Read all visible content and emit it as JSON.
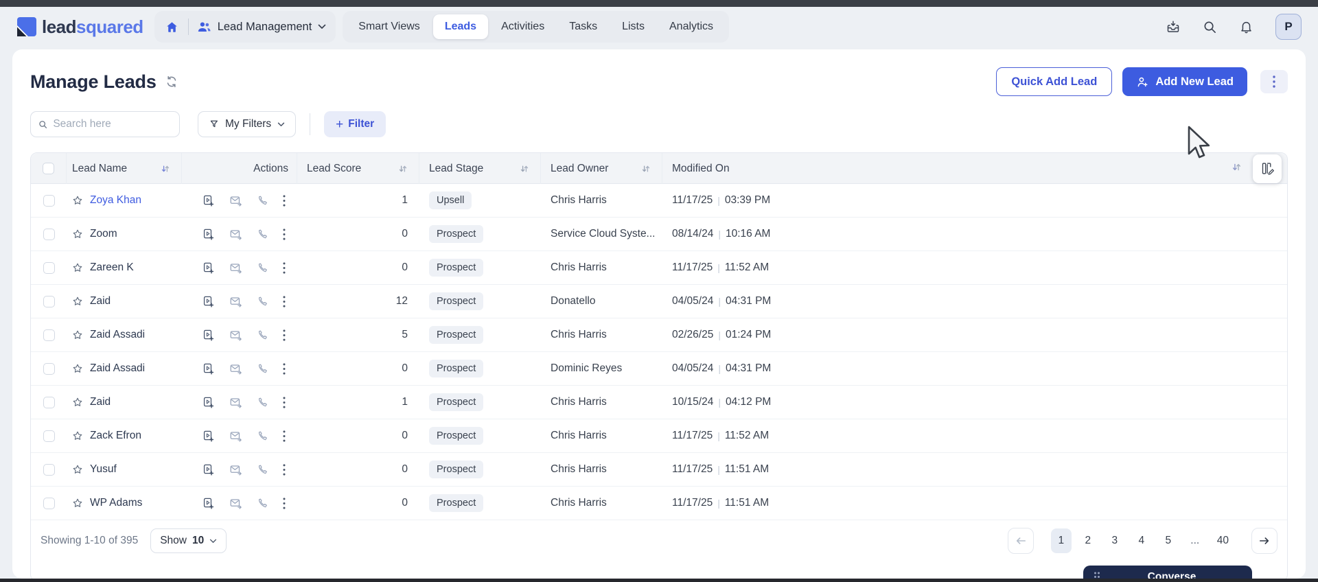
{
  "brand": {
    "part1": "lead",
    "part2": "squared"
  },
  "nav": {
    "menu_label": "Lead Management",
    "tabs": [
      {
        "label": "Smart Views",
        "active": false
      },
      {
        "label": "Leads",
        "active": true
      },
      {
        "label": "Activities",
        "active": false
      },
      {
        "label": "Tasks",
        "active": false
      },
      {
        "label": "Lists",
        "active": false
      },
      {
        "label": "Analytics",
        "active": false
      }
    ],
    "icons": [
      "home-icon",
      "users-icon",
      "inbox-download-icon",
      "search-icon",
      "bell-icon"
    ],
    "avatar_initial": "P"
  },
  "header": {
    "title": "Manage Leads",
    "quick_add_label": "Quick Add Lead",
    "add_new_label": "Add New Lead"
  },
  "toolbar": {
    "search_placeholder": "Search here",
    "my_filters_label": "My Filters",
    "filter_plus": "+",
    "filter_label": "Filter"
  },
  "table": {
    "separator": "|",
    "columns": [
      {
        "label": "Lead Name",
        "sortable": true
      },
      {
        "label": "Actions",
        "sortable": false
      },
      {
        "label": "Lead Score",
        "sortable": true
      },
      {
        "label": "Lead Stage",
        "sortable": true
      },
      {
        "label": "Lead Owner",
        "sortable": true
      },
      {
        "label": "Modified On",
        "sortable": false
      }
    ],
    "rows": [
      {
        "name": "Zoya Khan",
        "link": true,
        "score": "1",
        "stage": "Upsell",
        "owner": "Chris Harris",
        "date": "11/17/25",
        "time": "03:39 PM"
      },
      {
        "name": "Zoom",
        "link": false,
        "score": "0",
        "stage": "Prospect",
        "owner": "Service Cloud Syste...",
        "date": "08/14/24",
        "time": "10:16 AM"
      },
      {
        "name": "Zareen K",
        "link": false,
        "score": "0",
        "stage": "Prospect",
        "owner": "Chris Harris",
        "date": "11/17/25",
        "time": "11:52 AM"
      },
      {
        "name": "Zaid",
        "link": false,
        "score": "12",
        "stage": "Prospect",
        "owner": "Donatello",
        "date": "04/05/24",
        "time": "04:31 PM"
      },
      {
        "name": "Zaid Assadi",
        "link": false,
        "score": "5",
        "stage": "Prospect",
        "owner": "Chris Harris",
        "date": "02/26/25",
        "time": "01:24 PM"
      },
      {
        "name": "Zaid Assadi",
        "link": false,
        "score": "0",
        "stage": "Prospect",
        "owner": "Dominic Reyes",
        "date": "04/05/24",
        "time": "04:31 PM"
      },
      {
        "name": "Zaid",
        "link": false,
        "score": "1",
        "stage": "Prospect",
        "owner": "Chris Harris",
        "date": "10/15/24",
        "time": "04:12 PM"
      },
      {
        "name": "Zack Efron",
        "link": false,
        "score": "0",
        "stage": "Prospect",
        "owner": "Chris Harris",
        "date": "11/17/25",
        "time": "11:52 AM"
      },
      {
        "name": "Yusuf",
        "link": false,
        "score": "0",
        "stage": "Prospect",
        "owner": "Chris Harris",
        "date": "11/17/25",
        "time": "11:51 AM"
      },
      {
        "name": "WP Adams",
        "link": false,
        "score": "0",
        "stage": "Prospect",
        "owner": "Chris Harris",
        "date": "11/17/25",
        "time": "11:51 AM"
      }
    ]
  },
  "footer": {
    "showing": "Showing 1-10 of 395",
    "show_label": "Show",
    "show_value": "10",
    "pages": [
      {
        "label": "1",
        "active": true
      },
      {
        "label": "2",
        "active": false
      },
      {
        "label": "3",
        "active": false
      },
      {
        "label": "4",
        "active": false
      },
      {
        "label": "5",
        "active": false
      },
      {
        "label": "...",
        "active": false,
        "dots": true
      },
      {
        "label": "40",
        "active": false
      }
    ]
  },
  "converse": {
    "label": "Converse"
  },
  "colors": {
    "accent_blue": "#3d5ce0",
    "link_blue": "#3e5be0",
    "navy_text": "#222b44",
    "badge_bg": "#eef1f6",
    "table_header_bg": "#f2f4f7",
    "page_bg": "#edf0f4",
    "converse_bg": "#1d2a4d"
  }
}
